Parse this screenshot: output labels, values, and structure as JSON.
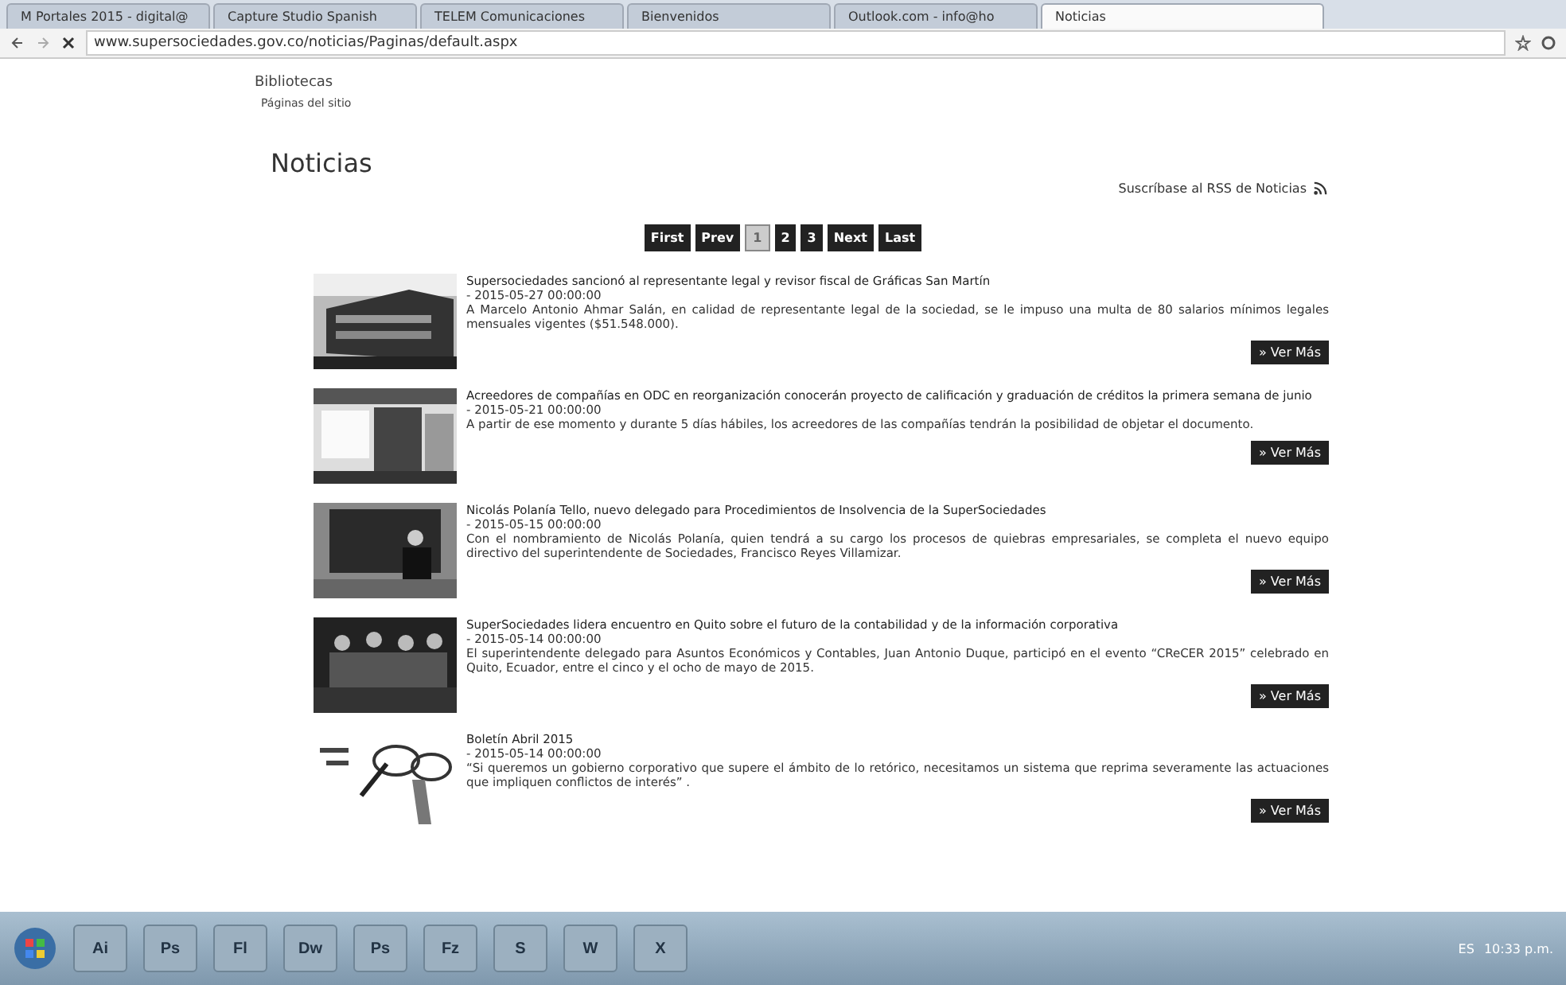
{
  "tabs": [
    {
      "label": "M Portales 2015 - digital@",
      "selected": false
    },
    {
      "label": "Capture Studio Spanish",
      "selected": false
    },
    {
      "label": "TELEM Comunicaciones",
      "selected": false
    },
    {
      "label": "Bienvenidos",
      "selected": false
    },
    {
      "label": "Outlook.com - info@ho",
      "selected": false
    },
    {
      "label": "Noticias",
      "selected": true
    }
  ],
  "address_bar": {
    "url": "www.supersociedades.gov.co/noticias/Paginas/default.aspx"
  },
  "breadcrumb": {
    "site": "Bibliotecas",
    "section": "Páginas del sitio"
  },
  "page_title": "Noticias",
  "rss_link": "Suscríbase al RSS de Noticias",
  "pagination": [
    {
      "label": "First",
      "selected": false
    },
    {
      "label": "Prev",
      "selected": false
    },
    {
      "label": "1",
      "selected": true
    },
    {
      "label": "2",
      "selected": false
    },
    {
      "label": "3",
      "selected": false
    },
    {
      "label": "Next",
      "selected": false
    },
    {
      "label": "Last",
      "selected": false
    }
  ],
  "news": [
    {
      "title": "Supersociedades sancionó al representante legal y revisor fiscal de Gráficas San Martín",
      "date": "- 2015-05-27 00:00:00",
      "summary": "A Marcelo Antonio Ahmar Salán, en calidad de representante legal de la sociedad, se le impuso una multa de 80 salarios mínimos legales mensuales vigentes ($51.548.000).",
      "button": "» Ver Más"
    },
    {
      "title": "Acreedores de compañías en ODC en reorganización conocerán proyecto de calificación y graduación de créditos la primera semana de junio",
      "date": "- 2015-05-21 00:00:00",
      "summary": "A partir de ese momento y durante 5 días hábiles, los acreedores de las compañías tendrán la posibilidad de objetar el documento.",
      "button": "» Ver Más"
    },
    {
      "title": "Nicolás Polanía Tello, nuevo delegado para Procedimientos de Insolvencia de la SuperSociedades",
      "date": "- 2015-05-15 00:00:00",
      "summary": "Con el nombramiento de Nicolás Polanía, quien tendrá a su cargo los procesos de quiebras empresariales, se completa el nuevo equipo directivo del superintendente de Sociedades, Francisco Reyes Villamizar.",
      "button": "» Ver Más"
    },
    {
      "title": "SuperSociedades lidera encuentro en Quito sobre el futuro de la contabilidad y de la información corporativa",
      "date": "- 2015-05-14 00:00:00",
      "summary": "El superintendente delegado para Asuntos Económicos y Contables, Juan Antonio Duque, participó en el evento “CReCER 2015” celebrado en Quito, Ecuador, entre el cinco y el ocho de mayo de 2015.",
      "button": "» Ver Más"
    },
    {
      "title": "Boletín Abril 2015",
      "date": "- 2015-05-14 00:00:00",
      "summary": "“Si queremos un gobierno corporativo que supere el ámbito de lo retórico, necesitamos un sistema que reprima severamente las actuaciones que impliquen conflictos de interés” .",
      "button": "» Ver Más"
    }
  ],
  "taskbar": {
    "apps": [
      "Ai",
      "Ps",
      "Fl",
      "Dw",
      "Ps",
      "Fz",
      "S",
      "W",
      "X"
    ],
    "language": "ES",
    "clock": "10:33 p.m."
  }
}
